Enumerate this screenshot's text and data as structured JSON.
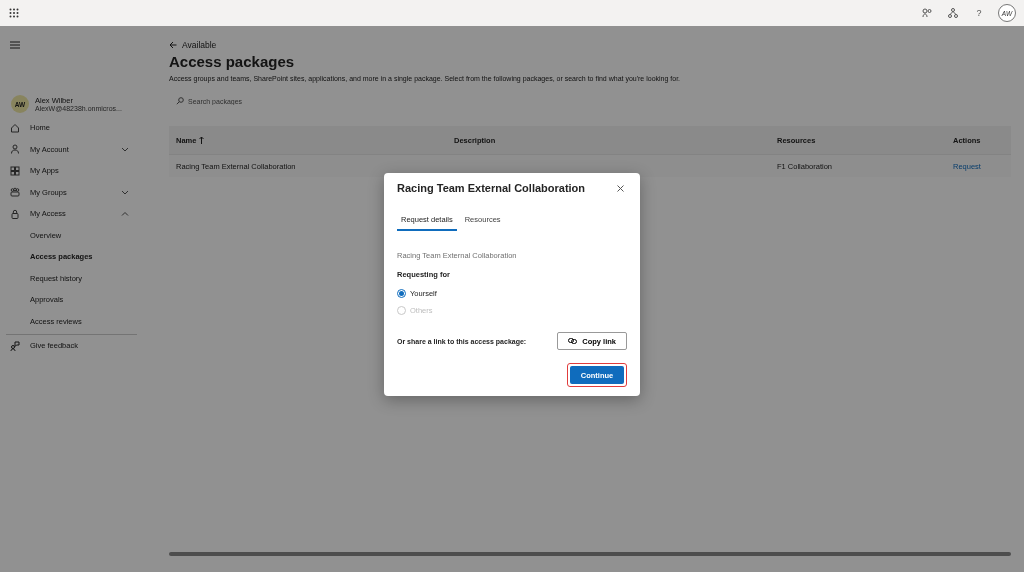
{
  "top_bar": {
    "help": "?",
    "avatar": "AW"
  },
  "sidebar": {
    "user": {
      "initials": "AW",
      "name": "Alex Wilber",
      "email": "AlexW@48238h.onmicros..."
    },
    "items": [
      {
        "label": "Home",
        "kind": "link"
      },
      {
        "label": "My Account",
        "kind": "group",
        "expanded": false
      },
      {
        "label": "My Apps",
        "kind": "link"
      },
      {
        "label": "My Groups",
        "kind": "group",
        "expanded": false
      },
      {
        "label": "My Access",
        "kind": "group",
        "expanded": true,
        "children": [
          {
            "label": "Overview",
            "selected": false
          },
          {
            "label": "Access packages",
            "selected": true
          },
          {
            "label": "Request history",
            "selected": false
          },
          {
            "label": "Approvals",
            "selected": false
          },
          {
            "label": "Access reviews",
            "selected": false
          }
        ]
      }
    ],
    "feedback": "Give feedback"
  },
  "main": {
    "back_link": "Available",
    "title": "Access packages",
    "description": "Access groups and teams, SharePoint sites, applications, and more in a single package. Select from the following packages, or search to find what you're looking for.",
    "search": {
      "placeholder": "Search packages"
    },
    "table": {
      "columns": [
        {
          "label": "Name",
          "sorted": true
        },
        {
          "label": "Description",
          "sorted": false
        },
        {
          "label": "Resources",
          "sorted": false
        },
        {
          "label": "Actions",
          "sorted": false
        }
      ],
      "rows": [
        {
          "name": "Racing Team External Collaboration",
          "resources": "F1 Collaboration",
          "action": "Request"
        }
      ]
    }
  },
  "dialog": {
    "title": "Racing Team External Collaboration",
    "tabs": [
      {
        "label": "Request details",
        "selected": true
      },
      {
        "label": "Resources",
        "selected": false
      }
    ],
    "package_name": "Racing Team External Collaboration",
    "requesting_label": "Requesting for",
    "options": [
      {
        "label": "Yourself",
        "selected": true,
        "disabled": false
      },
      {
        "label": "Others",
        "selected": false,
        "disabled": true
      }
    ],
    "share_label": "Or share a link to this access package:",
    "copy_button": "Copy link",
    "continue_button": "Continue",
    "continue_highlighted": true
  }
}
